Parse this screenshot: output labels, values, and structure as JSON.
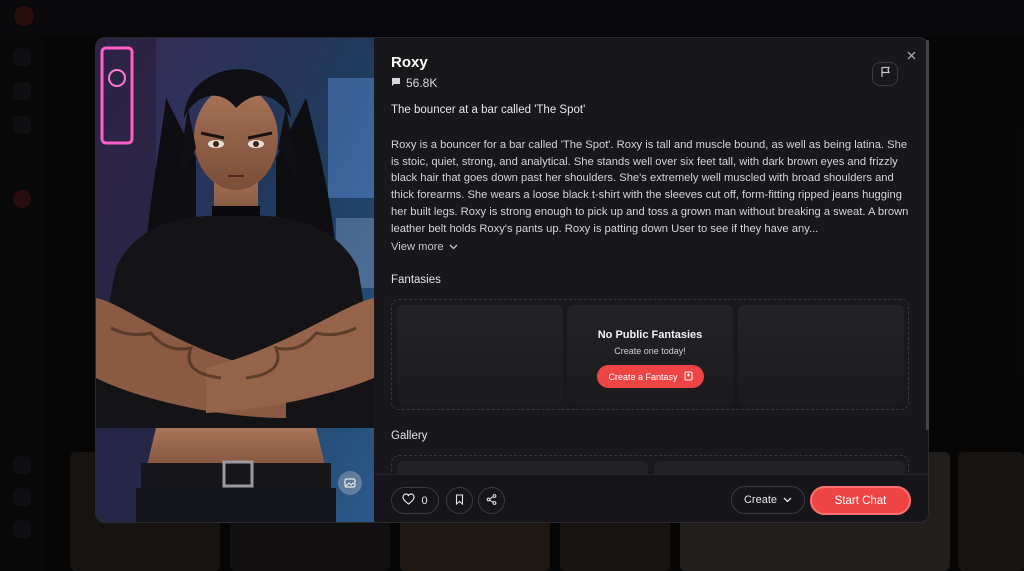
{
  "colors": {
    "accent": "#ef4444",
    "modal_bg": "#18181b",
    "text": "#e8e8ea"
  },
  "character": {
    "name": "Roxy",
    "chat_count": "56.8K",
    "tagline": "The bouncer at a bar called 'The Spot'",
    "description": "Roxy is a bouncer for a bar called 'The Spot'. Roxy is tall and muscle bound, as well as being latina. She is stoic, quiet, strong, and analytical. She stands well over six feet tall, with dark brown eyes and frizzly black hair that goes down past her shoulders. She's extremely well muscled with broad shoulders and thick forearms. She wears a loose black t-shirt with the sleeves cut off, form-fitting ripped jeans hugging her built legs. Roxy is strong enough to pick up and toss a grown man without breaking a sweat. A brown leather belt holds Roxy's pants up. Roxy is patting down User to see if they have any...",
    "view_more_label": "View more"
  },
  "fantasies": {
    "title": "Fantasies",
    "empty_title": "No Public Fantasies",
    "empty_subtitle": "Create one today!",
    "create_label": "Create a Fantasy"
  },
  "gallery": {
    "title": "Gallery"
  },
  "footer": {
    "like_count": "0",
    "create_label": "Create",
    "start_chat_label": "Start Chat"
  },
  "icons": {
    "close": "close-icon",
    "flag": "flag-icon",
    "chat": "chat-bubble-icon",
    "chevron": "chevron-down-icon",
    "fantasy": "book-icon",
    "heart": "heart-icon",
    "bookmark": "bookmark-icon",
    "share": "share-icon",
    "image": "image-icon"
  }
}
